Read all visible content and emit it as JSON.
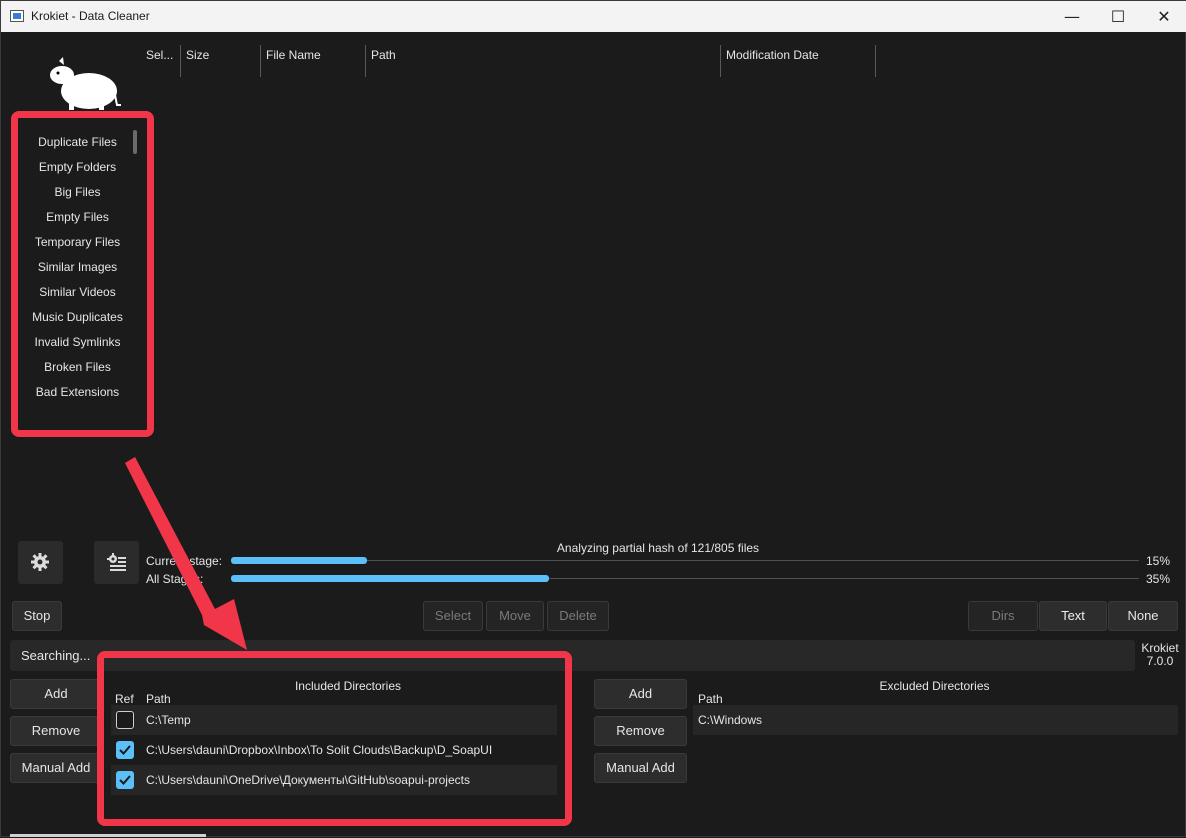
{
  "window": {
    "title": "Krokiet - Data Cleaner",
    "minimize_glyph": "—",
    "maximize_glyph": "☐",
    "close_glyph": "✕"
  },
  "results_table": {
    "columns": [
      "Sel...",
      "Size",
      "File Name",
      "Path",
      "Modification Date"
    ]
  },
  "tools": {
    "items": [
      "Duplicate Files",
      "Empty Folders",
      "Big Files",
      "Empty Files",
      "Temporary Files",
      "Similar Images",
      "Similar Videos",
      "Music Duplicates",
      "Invalid Symlinks",
      "Broken Files",
      "Bad Extensions"
    ]
  },
  "icon_buttons": {
    "settings_icon": "gear-icon",
    "scan_settings_icon": "tool-settings-icon"
  },
  "progress": {
    "title": "Analyzing partial hash of 121/805 files",
    "current_label": "Current stage:",
    "all_label": "All Stages:",
    "current_percent_text": "15%",
    "all_percent_text": "35%",
    "current_fraction": 0.15,
    "all_fraction": 0.35,
    "color": "#5bc0f8"
  },
  "action_buttons": {
    "stop": "Stop",
    "select": "Select",
    "move": "Move",
    "delete": "Delete",
    "dirs": "Dirs",
    "text": "Text",
    "none": "None"
  },
  "status": {
    "text": "Searching...",
    "app_name": "Krokiet",
    "version": "7.0.0"
  },
  "included": {
    "title": "Included Directories",
    "add": "Add",
    "remove": "Remove",
    "manual_add": "Manual Add",
    "col_ref": "Ref",
    "col_path": "Path",
    "rows": [
      {
        "ref": false,
        "path": "C:\\Temp"
      },
      {
        "ref": true,
        "path": "C:\\Users\\dauni\\Dropbox\\Inbox\\To Solit Clouds\\Backup\\D_SoapUI"
      },
      {
        "ref": true,
        "path": "C:\\Users\\dauni\\OneDrive\\Документы\\GitHub\\soapui-projects"
      }
    ]
  },
  "excluded": {
    "title": "Excluded Directories",
    "add": "Add",
    "remove": "Remove",
    "manual_add": "Manual Add",
    "col_path": "Path",
    "rows": [
      {
        "path": "C:\\Windows"
      }
    ]
  },
  "annotation_color": "#f2364a"
}
